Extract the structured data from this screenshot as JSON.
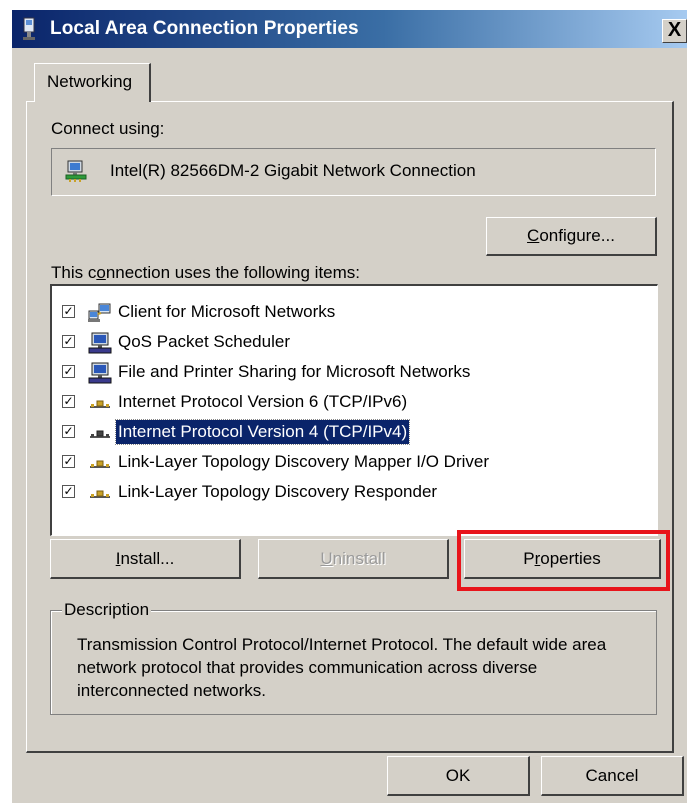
{
  "window": {
    "title": "Local Area Connection Properties",
    "close_label": "X"
  },
  "tabs": [
    {
      "label": "Networking",
      "selected": true
    }
  ],
  "connect_using": {
    "label": "Connect using:",
    "adapter": "Intel(R) 82566DM-2 Gigabit Network Connection",
    "icon": "network-adapter-icon"
  },
  "configure_button": {
    "pre": "",
    "key": "C",
    "post": "onfigure..."
  },
  "items_section": {
    "label_pre": "This c",
    "label_key": "o",
    "label_post": "nnection uses the following items:",
    "items": [
      {
        "label": "Client for Microsoft Networks",
        "checked": true,
        "icon": "network-client-icon",
        "selected": false
      },
      {
        "label": "QoS Packet Scheduler",
        "checked": true,
        "icon": "computer-service-icon",
        "selected": false
      },
      {
        "label": "File and Printer Sharing for Microsoft Networks",
        "checked": true,
        "icon": "computer-service-icon",
        "selected": false
      },
      {
        "label": "Internet Protocol Version 6 (TCP/IPv6)",
        "checked": true,
        "icon": "protocol-icon",
        "selected": false
      },
      {
        "label": "Internet Protocol Version 4 (TCP/IPv4)",
        "checked": true,
        "icon": "protocol-icon",
        "selected": true
      },
      {
        "label": "Link-Layer Topology Discovery Mapper I/O Driver",
        "checked": true,
        "icon": "protocol-icon",
        "selected": false
      },
      {
        "label": "Link-Layer Topology Discovery Responder",
        "checked": true,
        "icon": "protocol-icon",
        "selected": false
      }
    ]
  },
  "buttons": {
    "install": {
      "pre": "",
      "key": "I",
      "post": "nstall...",
      "enabled": true
    },
    "uninstall": {
      "pre": "",
      "key": "U",
      "post": "ninstall",
      "enabled": false
    },
    "properties": {
      "pre": "P",
      "key": "r",
      "post": "operties",
      "enabled": true,
      "highlighted": true
    }
  },
  "description": {
    "legend": "Description",
    "text": "Transmission Control Protocol/Internet Protocol. The default wide area network protocol that provides communication across diverse interconnected networks."
  },
  "footer": {
    "ok_label": "OK",
    "cancel_label": "Cancel"
  },
  "colors": {
    "dialog_bg": "#d4d0c8",
    "selection_bg": "#0a246a",
    "highlight_box": "#e8141b"
  }
}
